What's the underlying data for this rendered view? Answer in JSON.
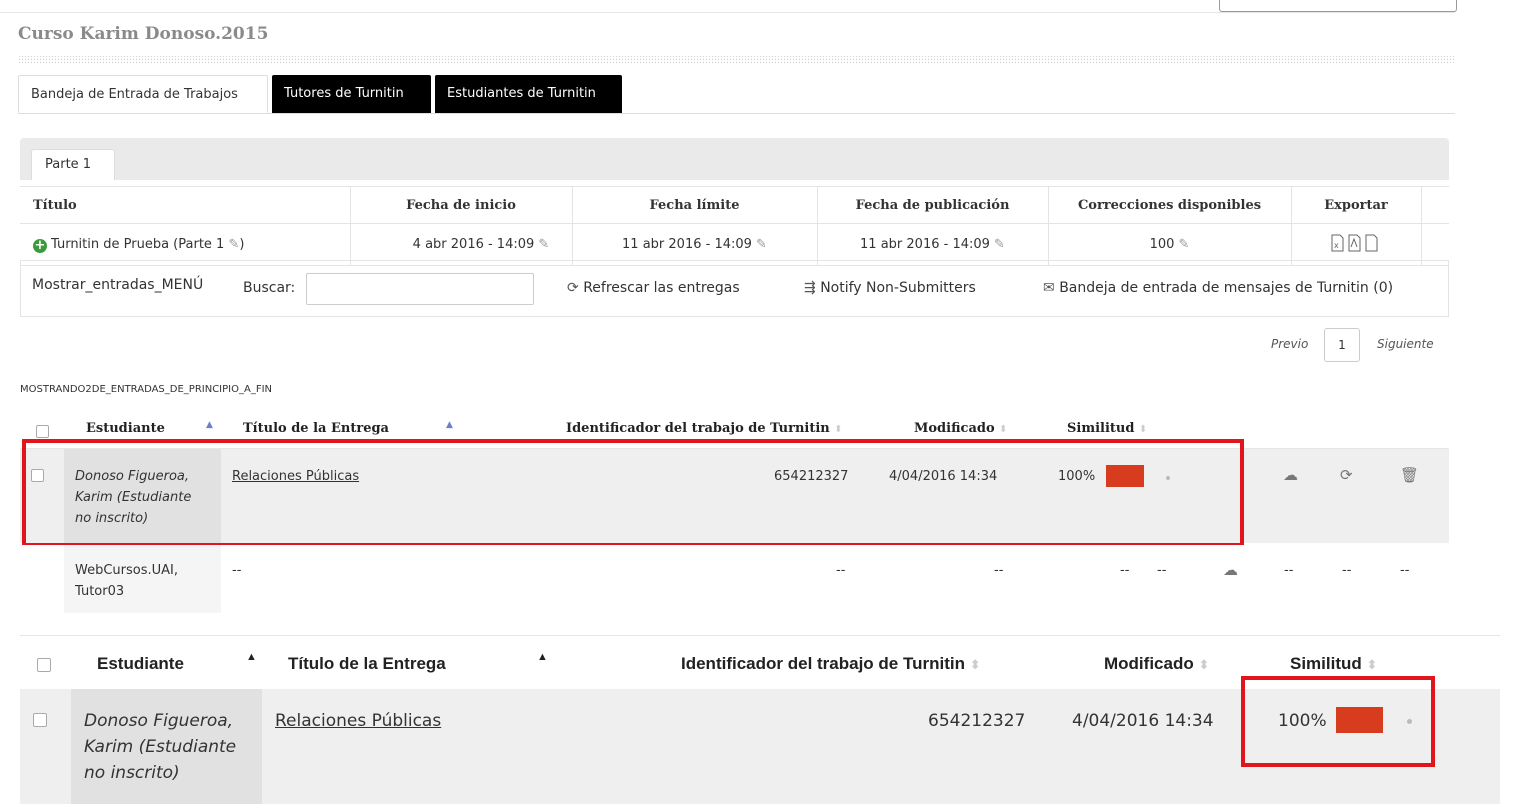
{
  "course_title": "Curso Karim Donoso.2015",
  "tabs": [
    {
      "label": "Bandeja de Entrada de Trabajos"
    },
    {
      "label": "Tutores de Turnitin"
    },
    {
      "label": "Estudiantes de Turnitin"
    }
  ],
  "part_tab": "Parte 1",
  "assignment_table": {
    "headers": [
      "Título",
      "Fecha de inicio",
      "Fecha límite",
      "Fecha de publicación",
      "Correcciones disponibles",
      "Exportar"
    ],
    "row": {
      "title": "Turnitin de Prueba (Parte 1",
      "title_close": ")",
      "start": "4 abr 2016 - 14:09",
      "due": "11 abr 2016 - 14:09",
      "post": "11 abr 2016 - 14:09",
      "marks": "100"
    }
  },
  "toolbar": {
    "show_entries": "Mostrar_entradas_MENÚ",
    "search_label": "Buscar:",
    "refresh": "Refrescar las entregas",
    "notify": "Notify Non-Submitters",
    "inbox": "Bandeja de entrada de mensajes de Turnitin (0)"
  },
  "pager": {
    "prev": "Previo",
    "page": "1",
    "next": "Siguiente"
  },
  "showing_text": "MOSTRANDO2DE_ENTRADAS_DE_PRINCIPIO_A_FIN",
  "submission_headers": {
    "student": "Estudiante",
    "title": "Título de la Entrega",
    "paper_id": "Identificador del trabajo de Turnitin",
    "modified": "Modificado",
    "similarity": "Similitud"
  },
  "submissions": [
    {
      "student_line1": "Donoso Figueroa,",
      "student_line2": "Karim (Estudiante",
      "student_line3": "no inscrito)",
      "title": "Relaciones Públicas",
      "paper_id": "654212327",
      "modified": "4/04/2016 14:34",
      "similarity": "100%"
    },
    {
      "student_line1": "WebCursos.UAI,",
      "student_line2": "Tutor03",
      "title": "--",
      "paper_id": "--",
      "modified": "--",
      "sim_a": "--",
      "sim_b": "--",
      "c1": "--",
      "c2": "--",
      "c3": "--"
    }
  ],
  "icons": {
    "add": "plus-circle-icon",
    "edit": "pencil-icon",
    "refresh": "refresh-icon",
    "notify": "reply-all-icon",
    "inbox": "envelope-icon",
    "upload": "cloud-upload-icon",
    "delete": "trash-icon",
    "export": [
      "xls-icon",
      "pdf-icon",
      "file-icon"
    ]
  },
  "colors": {
    "similarity_bar": "#d63c1d",
    "highlight_box": "#e0151d",
    "add_icon": "#3a9b3a"
  }
}
